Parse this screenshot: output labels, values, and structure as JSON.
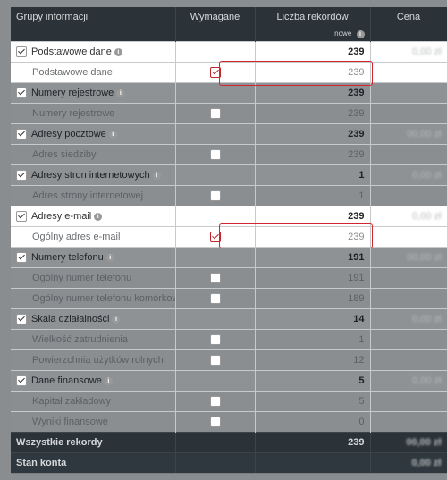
{
  "header": {
    "col_group": "Grupy informacji",
    "col_required": "Wymagane",
    "col_records": "Liczba rekordów",
    "col_price": "Cena",
    "sub_new": "nowe"
  },
  "rows": [
    {
      "kind": "group",
      "label": "Podstawowe dane",
      "checked": true,
      "count": "239",
      "price": "0,00 zł",
      "hl": true
    },
    {
      "kind": "sub",
      "label": "Podstawowe dane",
      "required": true,
      "count": "239",
      "hl": true,
      "box": true
    },
    {
      "kind": "group",
      "label": "Numery rejestrowe",
      "checked": true,
      "count": "239",
      "price": ""
    },
    {
      "kind": "sub",
      "label": "Numery rejestrowe",
      "required": false,
      "count": "239"
    },
    {
      "kind": "group",
      "label": "Adresy pocztowe",
      "checked": true,
      "count": "239",
      "price": "00,00 zł"
    },
    {
      "kind": "sub",
      "label": "Adres siedziby",
      "required": false,
      "count": "239"
    },
    {
      "kind": "group",
      "label": "Adresy stron internetowych",
      "checked": true,
      "count": "1",
      "price": "0,00 zł"
    },
    {
      "kind": "sub",
      "label": "Adres strony internetowej",
      "required": false,
      "count": "1"
    },
    {
      "kind": "group",
      "label": "Adresy e-mail",
      "checked": true,
      "count": "239",
      "price": "0,00 zł",
      "hl": true
    },
    {
      "kind": "sub",
      "label": "Ogólny adres e-mail",
      "required": true,
      "count": "239",
      "hl": true,
      "box": true
    },
    {
      "kind": "group",
      "label": "Numery telefonu",
      "checked": true,
      "count": "191",
      "price": "00,00 zł"
    },
    {
      "kind": "sub",
      "label": "Ogólny numer telefonu",
      "required": false,
      "count": "191"
    },
    {
      "kind": "sub",
      "label": "Ogólny numer telefonu komórkowego",
      "required": false,
      "count": "189"
    },
    {
      "kind": "group",
      "label": "Skala działalności",
      "checked": true,
      "count": "14",
      "price": "0,00 zł"
    },
    {
      "kind": "sub",
      "label": "Wielkość zatrudnienia",
      "required": false,
      "count": "1"
    },
    {
      "kind": "sub",
      "label": "Powierzchnia użytków rolnych",
      "required": false,
      "count": "12"
    },
    {
      "kind": "group",
      "label": "Dane finansowe",
      "checked": true,
      "count": "5",
      "price": "0,00 zł"
    },
    {
      "kind": "sub",
      "label": "Kapitał zakładowy",
      "required": false,
      "count": "5"
    },
    {
      "kind": "sub",
      "label": "Wyniki finansowe",
      "required": false,
      "count": "0"
    }
  ],
  "footer": {
    "total_label": "Wszystkie rekordy",
    "total_count": "239",
    "total_price": "00,00 zł",
    "balance_label": "Stan konta",
    "balance_value": "0,00 zł"
  }
}
